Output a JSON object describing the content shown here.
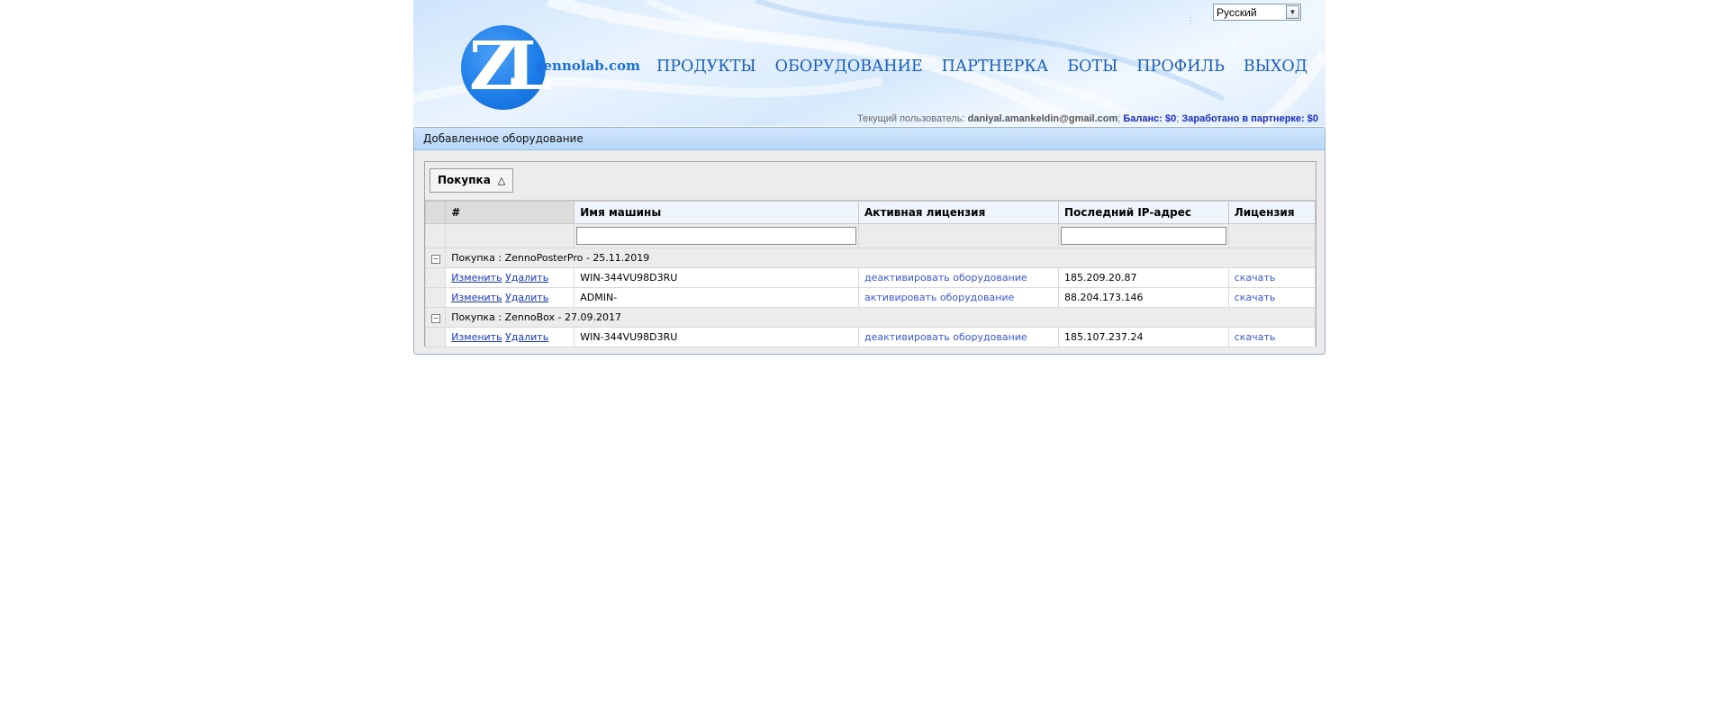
{
  "header": {
    "logo_text": "zennolab.com",
    "logo_letters": "ZL",
    "language": "Русский",
    "nav": [
      "ПРОДУКТЫ",
      "ОБОРУДОВАНИЕ",
      "ПАРТНЕРКА",
      "БОТЫ",
      "ПРОФИЛЬ",
      "ВЫХОД"
    ],
    "user_prefix": "Текущий пользователь: ",
    "user_email": "daniyal.amankeldin@gmail.com",
    "balance": "Баланс: $0",
    "earned": "Заработано в партнерке: $0"
  },
  "panel": {
    "title": "Добавленное оборудование",
    "group_chip": "Покупка",
    "group_chip_icon": "△",
    "columns": [
      "#",
      "Имя машины",
      "Активная лицензия",
      "Последний IP-адрес",
      "Лицензия"
    ],
    "groups": [
      {
        "label": "Покупка : ZennoPosterPro - 25.11.2019",
        "rows": [
          {
            "edit": "Изменить",
            "delete": "Удалить",
            "machine": "WIN-344VU98D3RU",
            "license_action": "деактивировать оборудование",
            "ip": "185.209.20.87",
            "download": "скачать"
          },
          {
            "edit": "Изменить",
            "delete": "Удалить",
            "machine": "ADMIN-",
            "license_action": "активировать оборудование",
            "ip": "88.204.173.146",
            "download": "скачать"
          }
        ]
      },
      {
        "label": "Покупка : ZennoBox - 27.09.2017",
        "rows": [
          {
            "edit": "Изменить",
            "delete": "Удалить",
            "machine": "WIN-344VU98D3RU",
            "license_action": "деактивировать оборудование",
            "ip": "185.107.237.24",
            "download": "скачать"
          }
        ]
      }
    ]
  }
}
